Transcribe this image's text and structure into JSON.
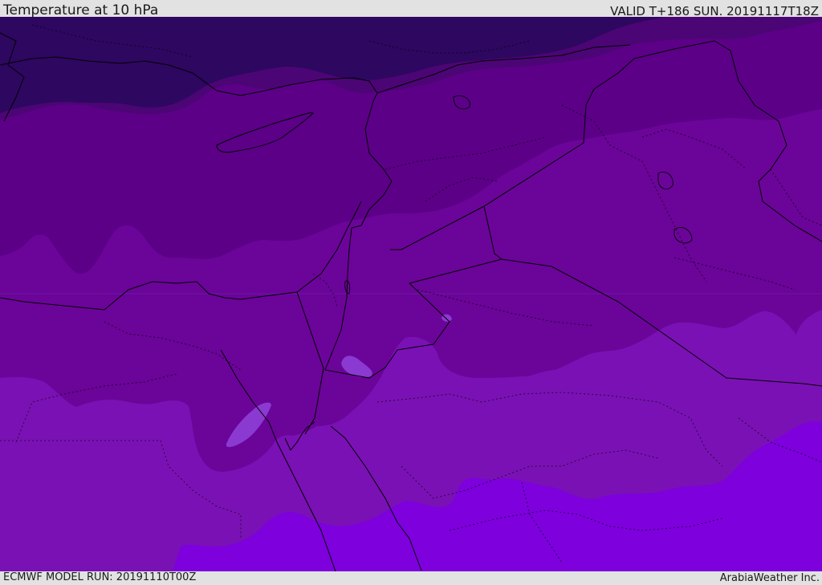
{
  "header": {
    "title": "Temperature at 10 hPa",
    "valid_time": "VALID T+186 SUN. 20191117T18Z"
  },
  "footer": {
    "model_run": "ECMWF MODEL RUN: 20191110T00Z",
    "credit": "ArabiaWeather Inc."
  },
  "map": {
    "variable": "Temperature",
    "level": "10 hPa",
    "colors": {
      "band_1_darkest": "#2e0760",
      "band_2": "#4c0575",
      "band_3": "#5c0088",
      "band_4": "#6b0499",
      "band_5": "#7a11b4",
      "band_6_brightest": "#7d00dd",
      "warm_spot": "#8a3ad1",
      "border_lines": "#000000"
    }
  }
}
